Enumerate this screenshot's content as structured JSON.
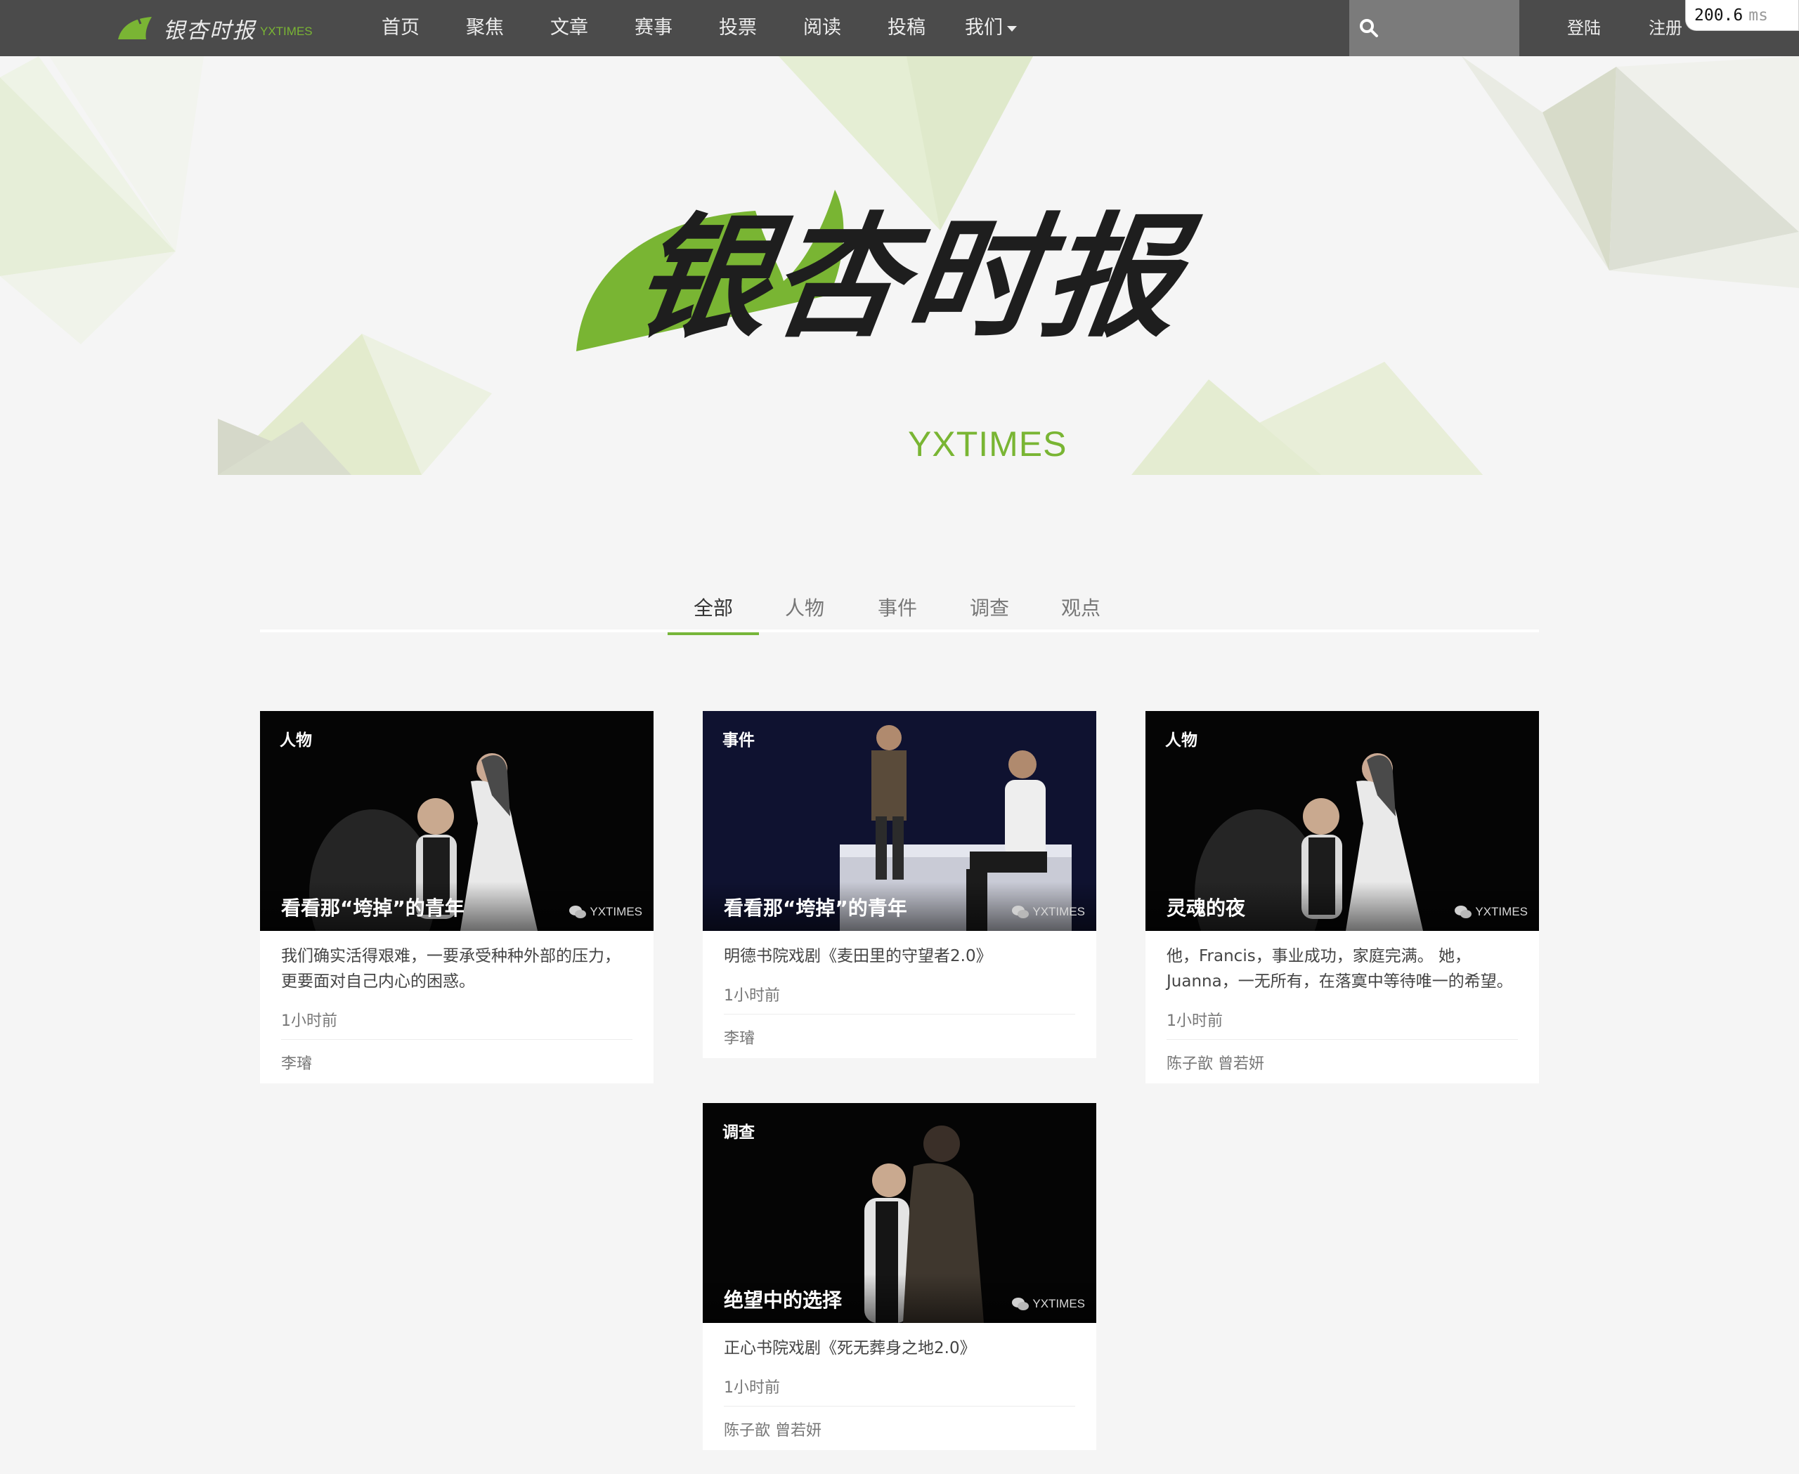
{
  "nav": {
    "brand_cn": "银杏时报",
    "brand_en": "YXTIMES",
    "items": [
      {
        "label": "首页"
      },
      {
        "label": "聚焦"
      },
      {
        "label": "文章"
      },
      {
        "label": "赛事"
      },
      {
        "label": "投票"
      },
      {
        "label": "阅读"
      },
      {
        "label": "投稿"
      },
      {
        "label": "我们"
      }
    ],
    "search_placeholder": "",
    "login": "登陆",
    "register": "注册",
    "timer_value": "200.6",
    "timer_unit": "ms"
  },
  "hero": {
    "logo_cn": "银杏时报",
    "logo_en": "YXTIMES"
  },
  "tabs": [
    {
      "label": "全部",
      "active": true
    },
    {
      "label": "人物",
      "active": false
    },
    {
      "label": "事件",
      "active": false
    },
    {
      "label": "调查",
      "active": false
    },
    {
      "label": "观点",
      "active": false
    }
  ],
  "cards": [
    {
      "tag": "人物",
      "title": "看看那“垮掉”的青年",
      "watermark": "YXTIMES",
      "desc": "我们确实活得艰难，一要承受种种外部的压力，更要面对自己内心的困惑。",
      "time": "1小时前",
      "author": "李璿"
    },
    {
      "tag": "事件",
      "title": "看看那“垮掉”的青年",
      "watermark": "YXTIMES",
      "desc": "明德书院戏剧《麦田里的守望者2.0》",
      "time": "1小时前",
      "author": "李璿"
    },
    {
      "tag": "人物",
      "title": "灵魂的夜",
      "watermark": "YXTIMES",
      "desc": "他，Francis，事业成功，家庭完满。 她，Juanna，一无所有，在落寞中等待唯一的希望。",
      "time": "1小时前",
      "author": "陈子歆 曾若妍"
    },
    {
      "tag": "调查",
      "title": "绝望中的选择",
      "watermark": "YXTIMES",
      "desc": "正心书院戏剧《死无葬身之地2.0》",
      "time": "1小时前",
      "author": "陈子歆 曾若妍"
    }
  ],
  "icons": {
    "search": "search-icon",
    "ginkgo": "ginkgo-leaf-icon",
    "wechat": "wechat-icon"
  },
  "colors": {
    "nav_bg": "#4b4b4b",
    "accent_green": "#77b63a",
    "page_bg": "#f5f5f5"
  }
}
